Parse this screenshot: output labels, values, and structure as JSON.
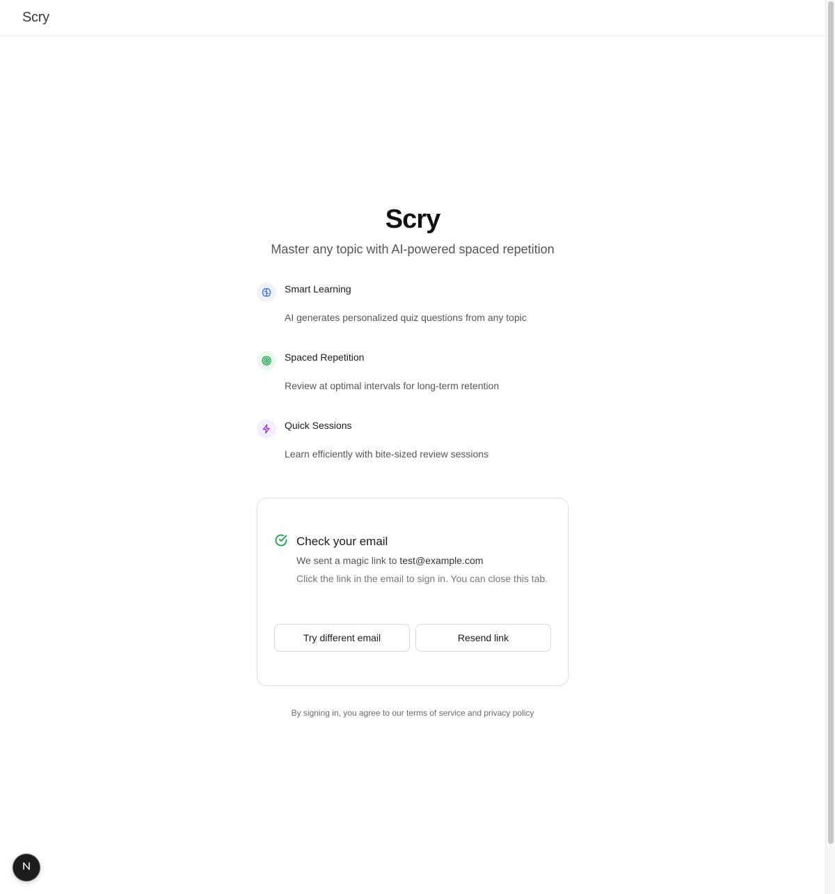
{
  "header": {
    "brand": "Scry"
  },
  "hero": {
    "title": "Scry",
    "subtitle": "Master any topic with AI-powered spaced repetition"
  },
  "features": [
    {
      "icon": "brain-icon",
      "icon_color": "#3b6fd8",
      "title": "Smart Learning",
      "description": "AI generates personalized quiz questions from any topic"
    },
    {
      "icon": "target-icon",
      "icon_color": "#16a34a",
      "title": "Spaced Repetition",
      "description": "Review at optimal intervals for long-term retention"
    },
    {
      "icon": "lightning-icon",
      "icon_color": "#9333ea",
      "title": "Quick Sessions",
      "description": "Learn efficiently with bite-sized review sessions"
    }
  ],
  "confirmation": {
    "icon": "check-circle-icon",
    "icon_color": "#16a34a",
    "title": "Check your email",
    "sent_prefix": "We sent a magic link to",
    "email": "test@example.com",
    "note": "Click the link in the email to sign in. You can close this tab.",
    "try_different_label": "Try different email",
    "resend_label": "Resend link"
  },
  "legal": {
    "text": "By signing in, you agree to our terms of service and privacy policy"
  },
  "dev_badge": {
    "letter_icon": "nextjs-logo-icon"
  }
}
